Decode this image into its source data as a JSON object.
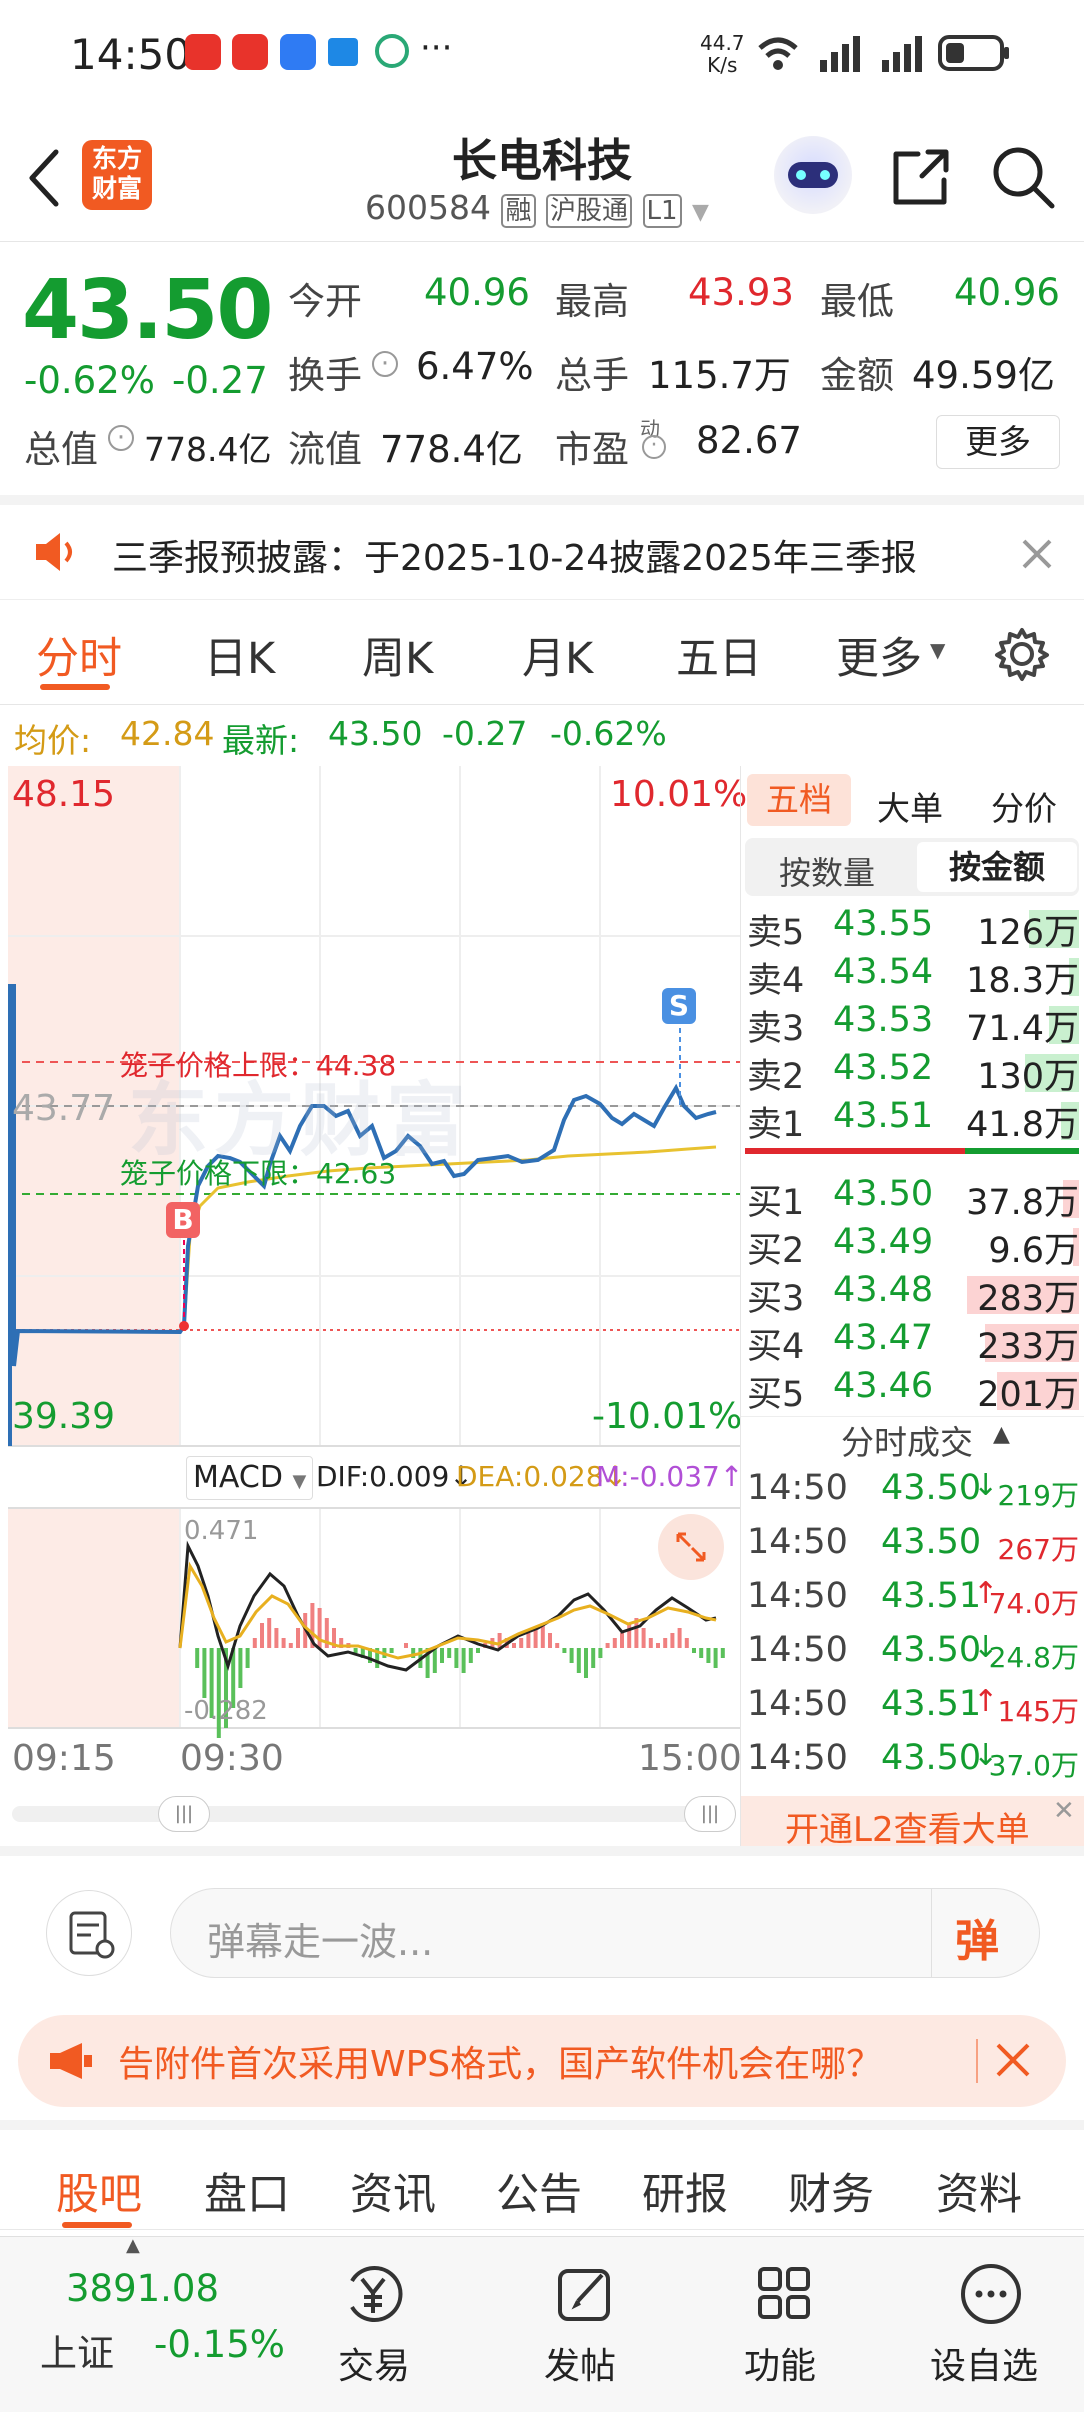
{
  "status_bar": {
    "time": "14:50",
    "net_speed_top": "44.7",
    "net_speed_unit": "K/s",
    "battery": "",
    "dots": "···"
  },
  "nav": {
    "back_icon": "chevron-left",
    "logo_line1": "东方",
    "logo_line2": "财富",
    "title": "长电科技",
    "code": "600584",
    "tag_margin": "融",
    "tag_connect": "沪股通",
    "tag_level": "L1"
  },
  "quote": {
    "price": "43.50",
    "change_pct": "-0.62%",
    "change": "-0.27",
    "open_label": "今开",
    "open": "40.96",
    "high_label": "最高",
    "high": "43.93",
    "low_label": "最低",
    "low": "40.96",
    "turnover_label": "换手",
    "turnover": "6.47%",
    "volume_label": "总手",
    "volume": "115.7万",
    "amount_label": "金额",
    "amount": "49.59亿",
    "mktcap_label": "总值",
    "mktcap": "778.4亿",
    "float_label": "流值",
    "float_cap": "778.4亿",
    "pe_label": "市盈",
    "pe_sup": "动",
    "pe": "82.67",
    "more_label": "更多"
  },
  "notice": {
    "text": "三季报预披露：于2025-10-24披露2025年三季报"
  },
  "tabs": {
    "items": [
      "分时",
      "日K",
      "周K",
      "月K",
      "五日",
      "更多"
    ],
    "active": "分时"
  },
  "avg_line": {
    "avg_label": "均价:",
    "avg": "42.84",
    "latest_label": "最新:",
    "latest": "43.50",
    "chg": "-0.27",
    "pct": "-0.62%"
  },
  "chart": {
    "top_price": "48.15",
    "top_pct": "10.01%",
    "bottom_price": "39.39",
    "bottom_pct": "-10.01%",
    "ref_price": "43.77",
    "upper_limit_label": "笼子价格上限：44.38",
    "lower_limit_label": "笼子价格下限：42.63",
    "watermark": "东方财富",
    "buy_marker": "B",
    "sell_marker": "S",
    "macd_name": "MACD",
    "dif": "DIF:0.009",
    "dea": "DEA:0.028",
    "m": "M:-0.037",
    "macd_top": "0.471",
    "macd_bottom": "-0.282",
    "time_labels": [
      "09:15",
      "09:30",
      "15:00"
    ]
  },
  "book": {
    "tabs": [
      "五档",
      "大单",
      "分价"
    ],
    "active_tab": "五档",
    "sub_tabs": [
      "按数量",
      "按金额"
    ],
    "active_sub": "按金额",
    "asks": [
      {
        "label": "卖5",
        "price": "43.55",
        "vol": "126万",
        "bar": 0.25
      },
      {
        "label": "卖4",
        "price": "43.54",
        "vol": "18.3万",
        "bar": 0.05
      },
      {
        "label": "卖3",
        "price": "43.53",
        "vol": "71.4万",
        "bar": 0.15
      },
      {
        "label": "卖2",
        "price": "43.52",
        "vol": "130万",
        "bar": 0.27
      },
      {
        "label": "卖1",
        "price": "43.51",
        "vol": "41.8万",
        "bar": 0.09
      }
    ],
    "bids": [
      {
        "label": "买1",
        "price": "43.50",
        "vol": "37.8万",
        "bar": 0.08
      },
      {
        "label": "买2",
        "price": "43.49",
        "vol": "9.6万",
        "bar": 0.03
      },
      {
        "label": "买3",
        "price": "43.48",
        "vol": "283万",
        "bar": 0.56
      },
      {
        "label": "买4",
        "price": "43.47",
        "vol": "233万",
        "bar": 0.47
      },
      {
        "label": "买5",
        "price": "43.46",
        "vol": "201万",
        "bar": 0.41
      }
    ],
    "trades_title": "分时成交",
    "trades": [
      {
        "time": "14:50",
        "price": "43.50",
        "arrow": "↓",
        "vol": "219万"
      },
      {
        "time": "14:50",
        "price": "43.50",
        "arrow": "",
        "vol": "267万"
      },
      {
        "time": "14:50",
        "price": "43.51",
        "arrow": "↑",
        "vol": "74.0万"
      },
      {
        "time": "14:50",
        "price": "43.50",
        "arrow": "↓",
        "vol": "24.8万"
      },
      {
        "time": "14:50",
        "price": "43.51",
        "arrow": "↑",
        "vol": "145万"
      },
      {
        "time": "14:50",
        "price": "43.50",
        "arrow": "↓",
        "vol": "37.0万"
      }
    ],
    "l2_promo": "开通L2查看大单"
  },
  "comment": {
    "placeholder": "弹幕走一波...",
    "danmu_btn": "弹"
  },
  "ad": {
    "text": "告附件首次采用WPS格式，国产软件机会在哪？"
  },
  "footer_tabs": {
    "items": [
      "股吧",
      "盘口",
      "资讯",
      "公告",
      "研报",
      "财务",
      "资料"
    ],
    "active": "股吧"
  },
  "bottom_nav": {
    "index_value": "3891.08",
    "index_name": "上证",
    "index_pct": "-0.15%",
    "items": [
      {
        "label": "交易",
        "icon": "yen-icon"
      },
      {
        "label": "发帖",
        "icon": "edit-icon"
      },
      {
        "label": "功能",
        "icon": "grid-icon"
      },
      {
        "label": "设自选",
        "icon": "more-icon"
      }
    ]
  }
}
